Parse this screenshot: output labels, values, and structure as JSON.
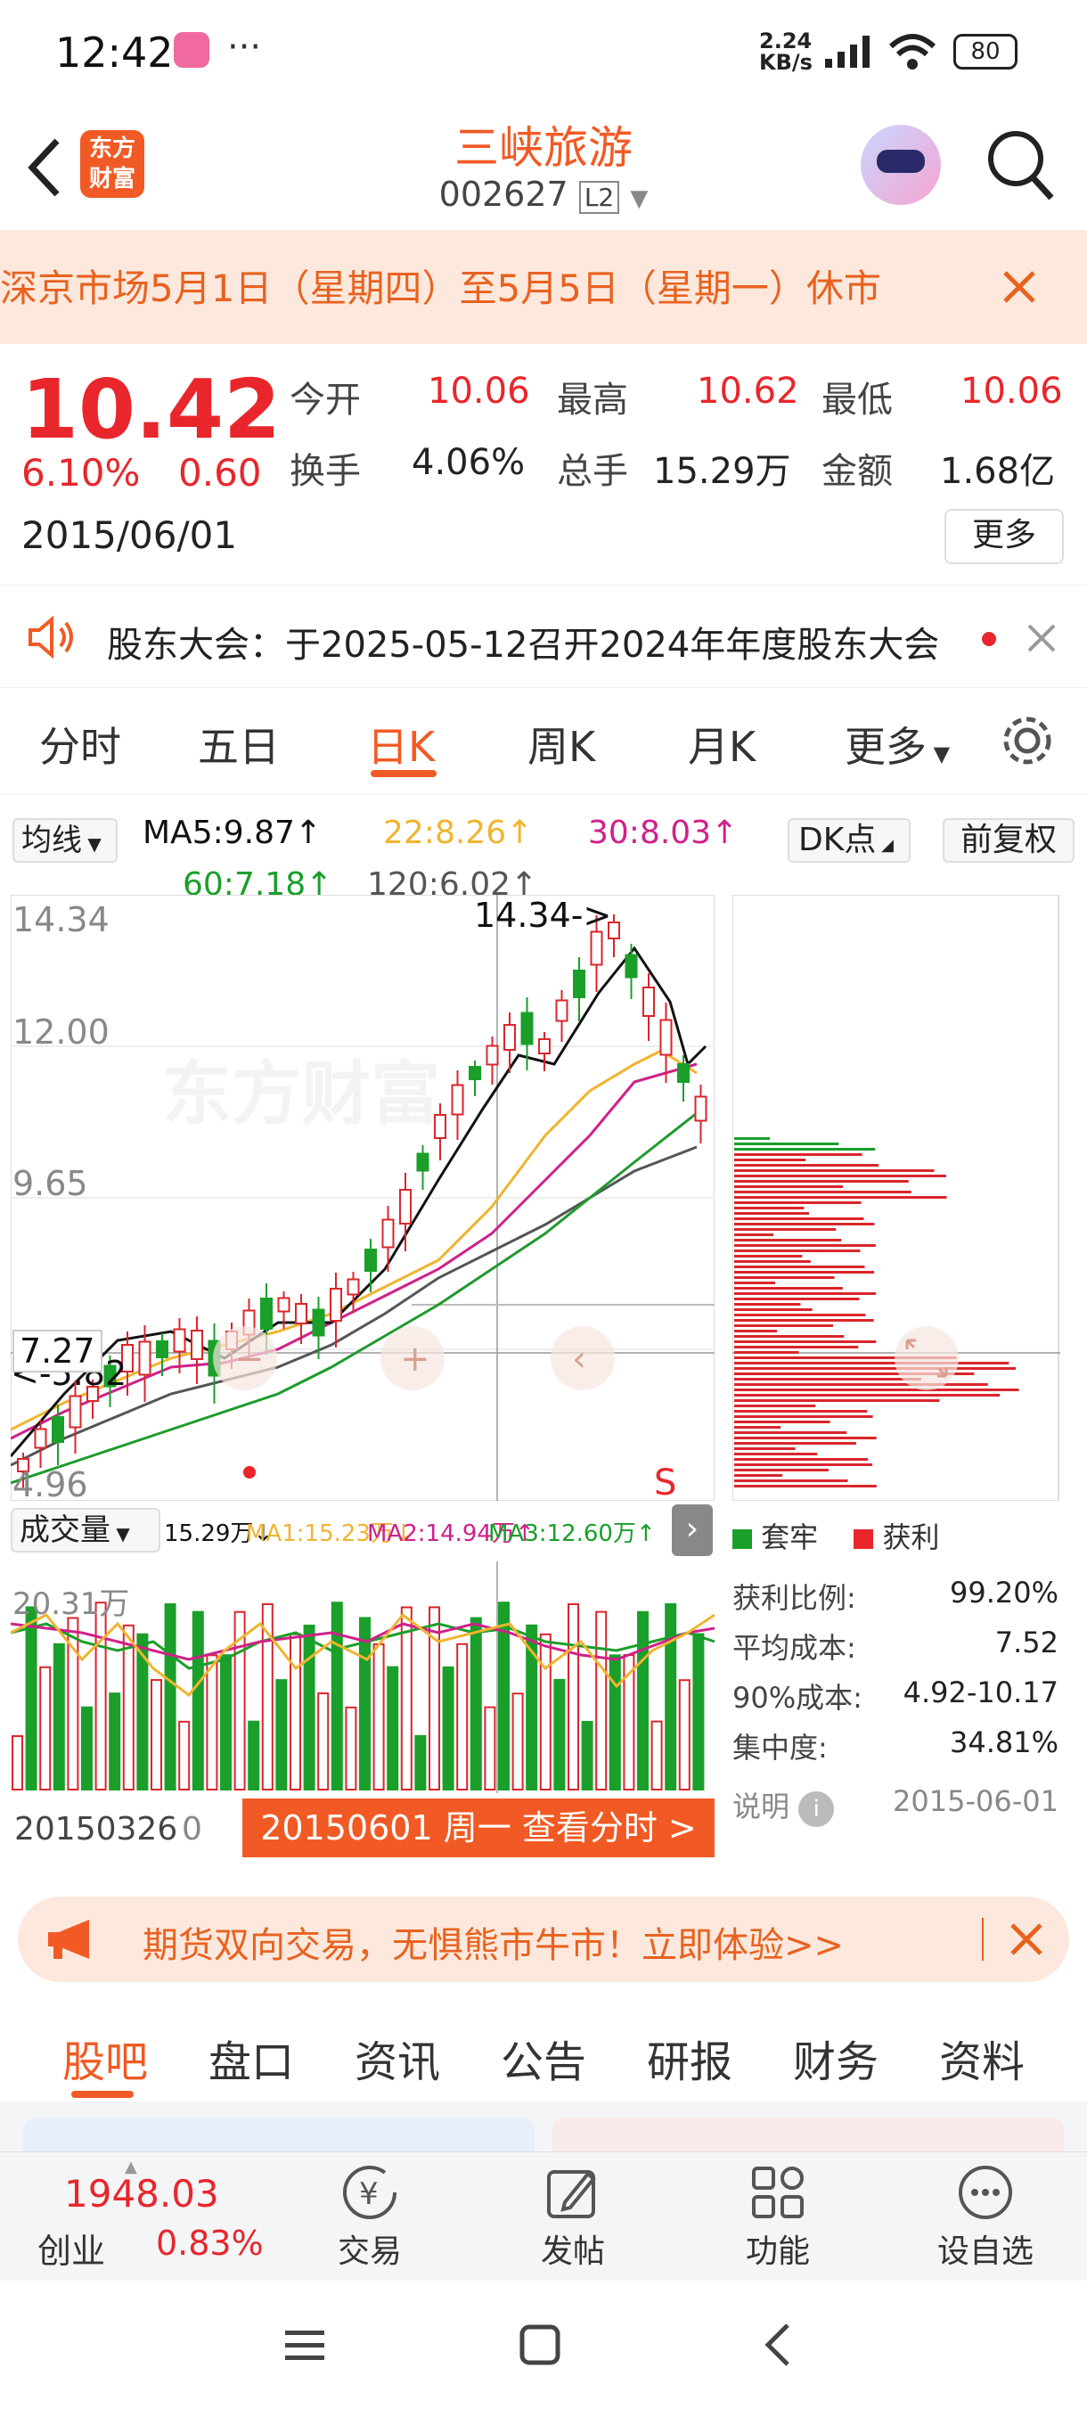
{
  "status": {
    "time": "12:42",
    "net_speed": "2.24",
    "net_unit": "KB/s",
    "battery": "80"
  },
  "header": {
    "title": "三峡旅游",
    "code": "002627",
    "level": "L2",
    "logo_line1": "东方",
    "logo_line2": "财富"
  },
  "banner": {
    "text": "深京市场5月1日（星期四）至5月5日（星期一）休市"
  },
  "quote": {
    "price": "10.42",
    "change_pct": "6.10%",
    "change": "0.60",
    "date": "2015/06/01",
    "fields": [
      {
        "label": "今开",
        "value": "10.06"
      },
      {
        "label": "最高",
        "value": "10.62"
      },
      {
        "label": "最低",
        "value": "10.06"
      },
      {
        "label": "换手",
        "value": "4.06%"
      },
      {
        "label": "总手",
        "value": "15.29万"
      },
      {
        "label": "金额",
        "value": "1.68亿"
      }
    ],
    "more_button": "更多"
  },
  "notice": {
    "text": "股东大会：于2025-05-12召开2024年年度股东大会"
  },
  "tabs": {
    "fen_shi": "分时",
    "wu_ri": "五日",
    "ri_k": "日K",
    "zhou_k": "周K",
    "yue_k": "月K",
    "geng_duo": "更多"
  },
  "chart": {
    "ma_selector": "均线",
    "ma5": "MA5:9.87",
    "ma22": "22:8.26",
    "ma30": "30:8.03",
    "ma60": "60:7.18",
    "ma120": "120:6.02",
    "dk_button": "DK点",
    "fq_button": "前复权",
    "y_labels": [
      "14.34",
      "12.00",
      "9.65",
      "7.27",
      "4.96"
    ],
    "high_marker": "14.34->",
    "low_marker": "<-5.82",
    "s_marker": "S",
    "volume_selector": "成交量",
    "vol_value": "15.29万",
    "vol_ma1": "MA1:15.23万",
    "vol_ma2": "MA2:14.94万",
    "vol_ma3": "MA3:12.60万",
    "vol_max": "20.31万",
    "start_date": "20150326",
    "start_zero": "0",
    "cursor_label": "20150601 周一 查看分时 >",
    "colors": {
      "up": "#d9262b",
      "down": "#1a9f2a",
      "ma5": "#111111",
      "ma22": "#f0b430",
      "ma30": "#d0208a",
      "ma60": "#1f9a2e",
      "ma120": "#555555"
    }
  },
  "chip": {
    "legend_trap": "套牢",
    "legend_profit": "获利",
    "rows": [
      {
        "label": "获利比例:",
        "value": "99.20%"
      },
      {
        "label": "平均成本:",
        "value": "7.52"
      },
      {
        "label": "90%成本:",
        "value": "4.92-10.17"
      },
      {
        "label": "集中度:",
        "value": "34.81%"
      }
    ],
    "note_label": "说明",
    "note_date": "2015-06-01"
  },
  "promo": {
    "text": "期货双向交易，无惧熊市牛市！立即体验>>"
  },
  "subtabs": [
    "股吧",
    "盘口",
    "资讯",
    "公告",
    "研报",
    "财务",
    "资料"
  ],
  "bottom": {
    "index_value": "1948.03",
    "index_name": "创业",
    "index_pct": "0.83%",
    "trade": "交易",
    "post": "发帖",
    "function": "功能",
    "watch": "设自选"
  }
}
